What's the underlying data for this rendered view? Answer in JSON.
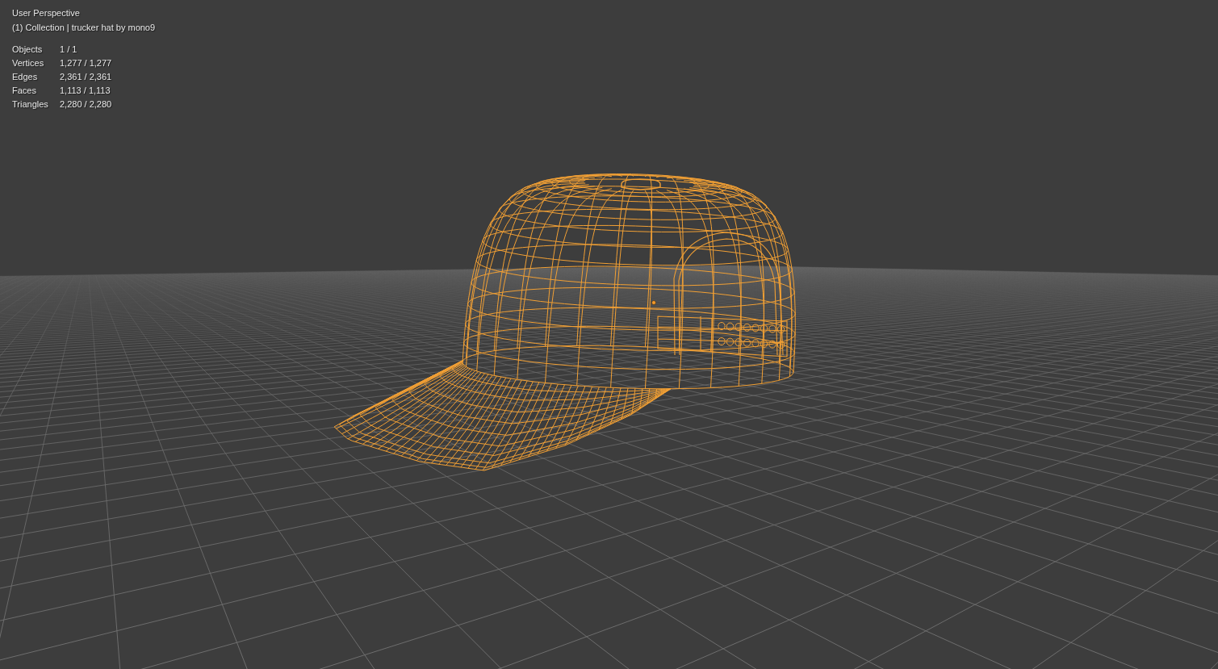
{
  "viewport": {
    "view_name": "User Perspective",
    "collection_info": "(1) Collection | trucker hat by mono9"
  },
  "statistics": [
    {
      "label": "Objects",
      "value": "1 / 1"
    },
    {
      "label": "Vertices",
      "value": "1,277 / 1,277"
    },
    {
      "label": "Edges",
      "value": "2,361 / 2,361"
    },
    {
      "label": "Faces",
      "value": "1,113 / 1,113"
    },
    {
      "label": "Triangles",
      "value": "2,280 / 2,280"
    }
  ]
}
